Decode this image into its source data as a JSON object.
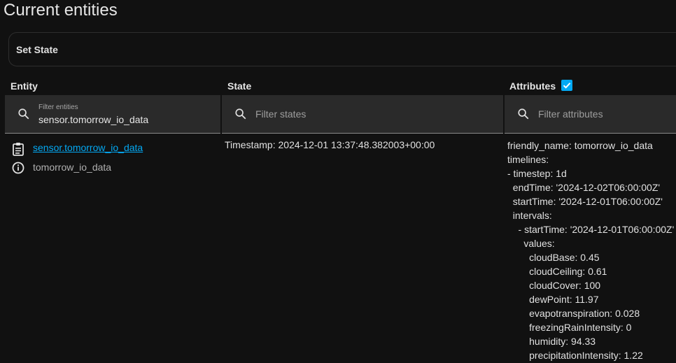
{
  "page": {
    "title": "Current entities"
  },
  "set_state": {
    "label": "Set State"
  },
  "columns": {
    "entity": "Entity",
    "state": "State",
    "attributes": "Attributes",
    "attributes_checked": true
  },
  "filters": {
    "entity": {
      "label": "Filter entities",
      "value": "sensor.tomorrow_io_data"
    },
    "state": {
      "placeholder": "Filter states"
    },
    "attributes": {
      "placeholder": "Filter attributes"
    }
  },
  "row": {
    "entity_id": "sensor.tomorrow_io_data",
    "entity_name": "tomorrow_io_data",
    "state": "Timestamp: 2024-12-01 13:37:48.382003+00:00",
    "attributes": [
      "friendly_name: tomorrow_io_data",
      "timelines:",
      "- timestep: 1d",
      "  endTime: '2024-12-02T06:00:00Z'",
      "  startTime: '2024-12-01T06:00:00Z'",
      "  intervals:",
      "    - startTime: '2024-12-01T06:00:00Z'",
      "      values:",
      "        cloudBase: 0.45",
      "        cloudCeiling: 0.61",
      "        cloudCover: 100",
      "        dewPoint: 11.97",
      "        evapotranspiration: 0.028",
      "        freezingRainIntensity: 0",
      "        humidity: 94.33",
      "        precipitationIntensity: 1.22"
    ]
  },
  "icons": {
    "filter": "search-icon",
    "entity": "clipboard-list-icon",
    "info": "information-outline-icon",
    "checkbox": "check-icon"
  },
  "colors": {
    "accent": "#03a9f4",
    "background": "#111111",
    "filter_bg": "#2a2a2a"
  }
}
